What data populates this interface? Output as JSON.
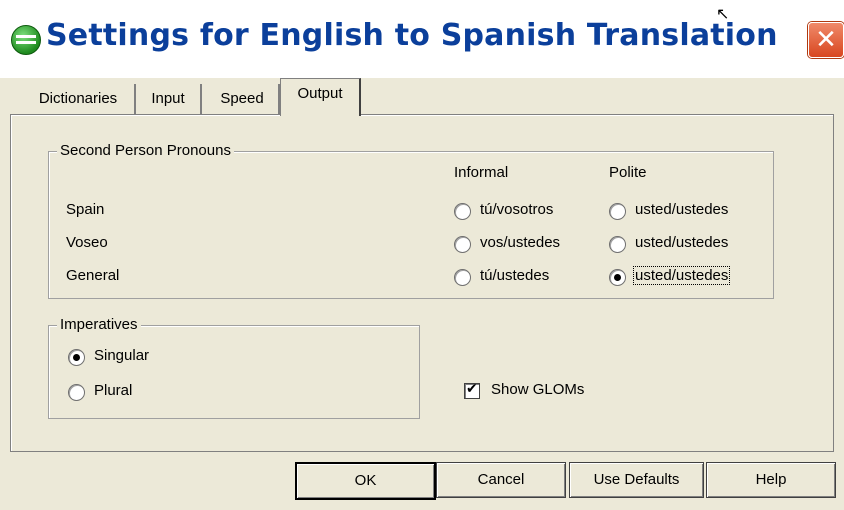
{
  "window": {
    "title": "Settings for English to Spanish Translation",
    "close_symbol": "✕"
  },
  "tabs": [
    {
      "label": "Dictionaries"
    },
    {
      "label": "Input"
    },
    {
      "label": "Speed"
    },
    {
      "label": "Output",
      "active": true
    }
  ],
  "pronouns": {
    "legend": "Second Person Pronouns",
    "informal_header": "Informal",
    "polite_header": "Polite",
    "rows": [
      {
        "label": "Spain",
        "informal": "tú/vosotros",
        "polite": "usted/ustedes",
        "informal_selected": false,
        "polite_selected": false
      },
      {
        "label": "Voseo",
        "informal": "vos/ustedes",
        "polite": "usted/ustedes",
        "informal_selected": false,
        "polite_selected": false
      },
      {
        "label": "General",
        "informal": "tú/ustedes",
        "polite": "usted/ustedes",
        "informal_selected": false,
        "polite_selected": true
      }
    ]
  },
  "imperatives": {
    "legend": "Imperatives",
    "options": [
      {
        "label": "Singular",
        "selected": true
      },
      {
        "label": "Plural",
        "selected": false
      }
    ]
  },
  "show_gloms": {
    "label": "Show GLOMs",
    "checked": true
  },
  "buttons": {
    "ok": "OK",
    "cancel": "Cancel",
    "defaults": "Use Defaults",
    "help": "Help"
  },
  "colors": {
    "dialog_bg": "#ece9d8",
    "title_text": "#0b3f9b",
    "close_button": "#d8461f"
  },
  "icons": {
    "app": "green-globe-icon",
    "close": "close-icon",
    "check": "checkmark-icon"
  }
}
